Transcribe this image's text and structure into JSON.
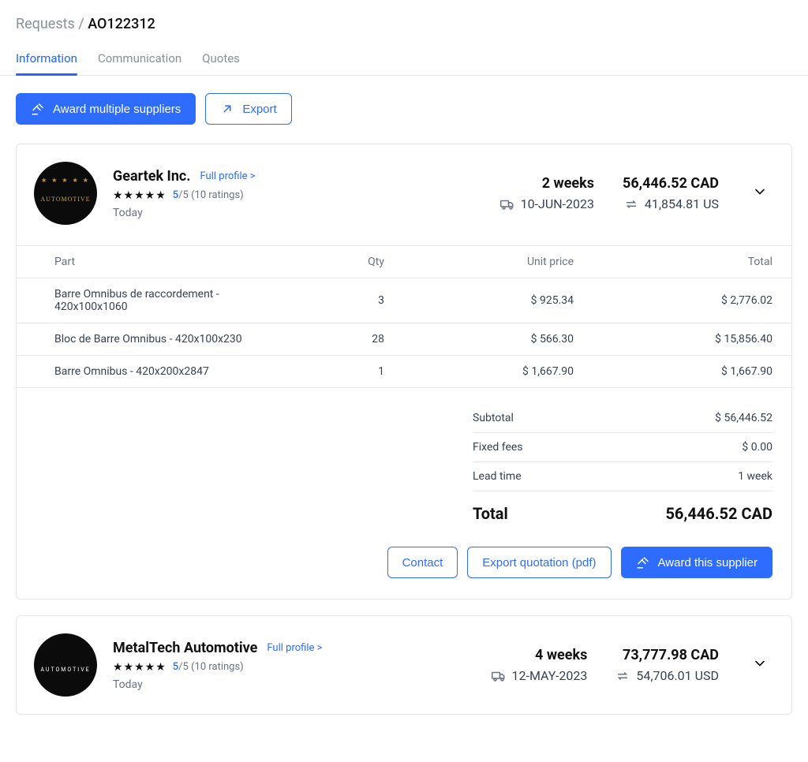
{
  "breadcrumb": {
    "root": "Requests",
    "id": "AO122312"
  },
  "tabs": [
    {
      "label": "Information",
      "active": true
    },
    {
      "label": "Communication",
      "active": false
    },
    {
      "label": "Quotes",
      "active": false
    }
  ],
  "toolbar": {
    "award_multiple": "Award multiple suppliers",
    "export": "Export"
  },
  "suppliers": [
    {
      "name": "Geartek Inc.",
      "full_profile_label": "Full profile >",
      "avatar_text": "AUTOMOTIVE",
      "rating_score": "5",
      "rating_of": "/5",
      "rating_count": "(10 ratings)",
      "when": "Today",
      "lead_time": "2 weeks",
      "delivery_date": "10-JUN-2023",
      "price_main": "56,446.52 CAD",
      "price_alt": "41,854.81 US",
      "table": {
        "headers": {
          "part": "Part",
          "qty": "Qty",
          "unit": "Unit price",
          "total": "Total"
        },
        "rows": [
          {
            "part": "Barre Omnibus de raccordement - 420x100x1060",
            "qty": "3",
            "unit": "$ 925.34",
            "total": "$ 2,776.02"
          },
          {
            "part": "Bloc de Barre Omnibus - 420x100x230",
            "qty": "28",
            "unit": "$ 566.30",
            "total": "$ 15,856.40"
          },
          {
            "part": "Barre Omnibus - 420x200x2847",
            "qty": "1",
            "unit": "$ 1,667.90",
            "total": "$ 1,667.90"
          }
        ],
        "summary": {
          "subtotal_label": "Subtotal",
          "subtotal": "$ 56,446.52",
          "fees_label": "Fixed fees",
          "fees": "$ 0.00",
          "lead_label": "Lead time",
          "lead": "1 week",
          "total_label": "Total",
          "total": "56,446.52 CAD"
        }
      },
      "actions": {
        "contact": "Contact",
        "export_pdf": "Export quotation (pdf)",
        "award": "Award this supplier"
      }
    },
    {
      "name": "MetalTech Automotive",
      "full_profile_label": "Full profile >",
      "avatar_text": "AUTOMOTIVE",
      "rating_score": "5",
      "rating_of": "/5",
      "rating_count": "(10 ratings)",
      "when": "Today",
      "lead_time": "4 weeks",
      "delivery_date": "12-MAY-2023",
      "price_main": "73,777.98 CAD",
      "price_alt": "54,706.01 USD"
    }
  ]
}
